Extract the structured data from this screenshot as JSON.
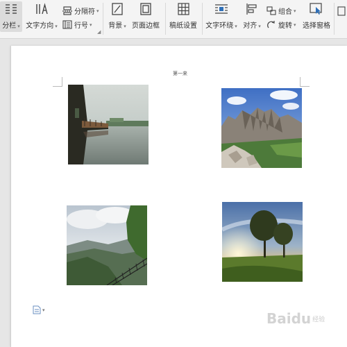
{
  "ribbon": {
    "columns": "分栏",
    "text_direction": "文字方向",
    "separator": "分隔符",
    "line_number": "行号",
    "background": "背景",
    "page_border": "页面边框",
    "manuscript_settings": "稿纸设置",
    "text_wrap": "文字环绕",
    "align": "对齐",
    "group": "组合",
    "rotate": "旋转",
    "selection_pane": "选择窗格"
  },
  "document": {
    "page_number": "第一来",
    "images": [
      {
        "name": "bridge-lake-photo",
        "subject": "lake bridge"
      },
      {
        "name": "mountains-photo",
        "subject": "mountains"
      },
      {
        "name": "valley-overlook-photo",
        "subject": "valley overlook"
      },
      {
        "name": "trees-sunset-photo",
        "subject": "trees at sunset"
      }
    ]
  },
  "watermark": {
    "brand": "Baidu",
    "sub": "经验"
  },
  "colors": {
    "ribbon_bg": "#f4f4f4",
    "canvas_bg": "#e6e6e6",
    "page_bg": "#ffffff",
    "icon_blue": "#2e6fb7"
  }
}
